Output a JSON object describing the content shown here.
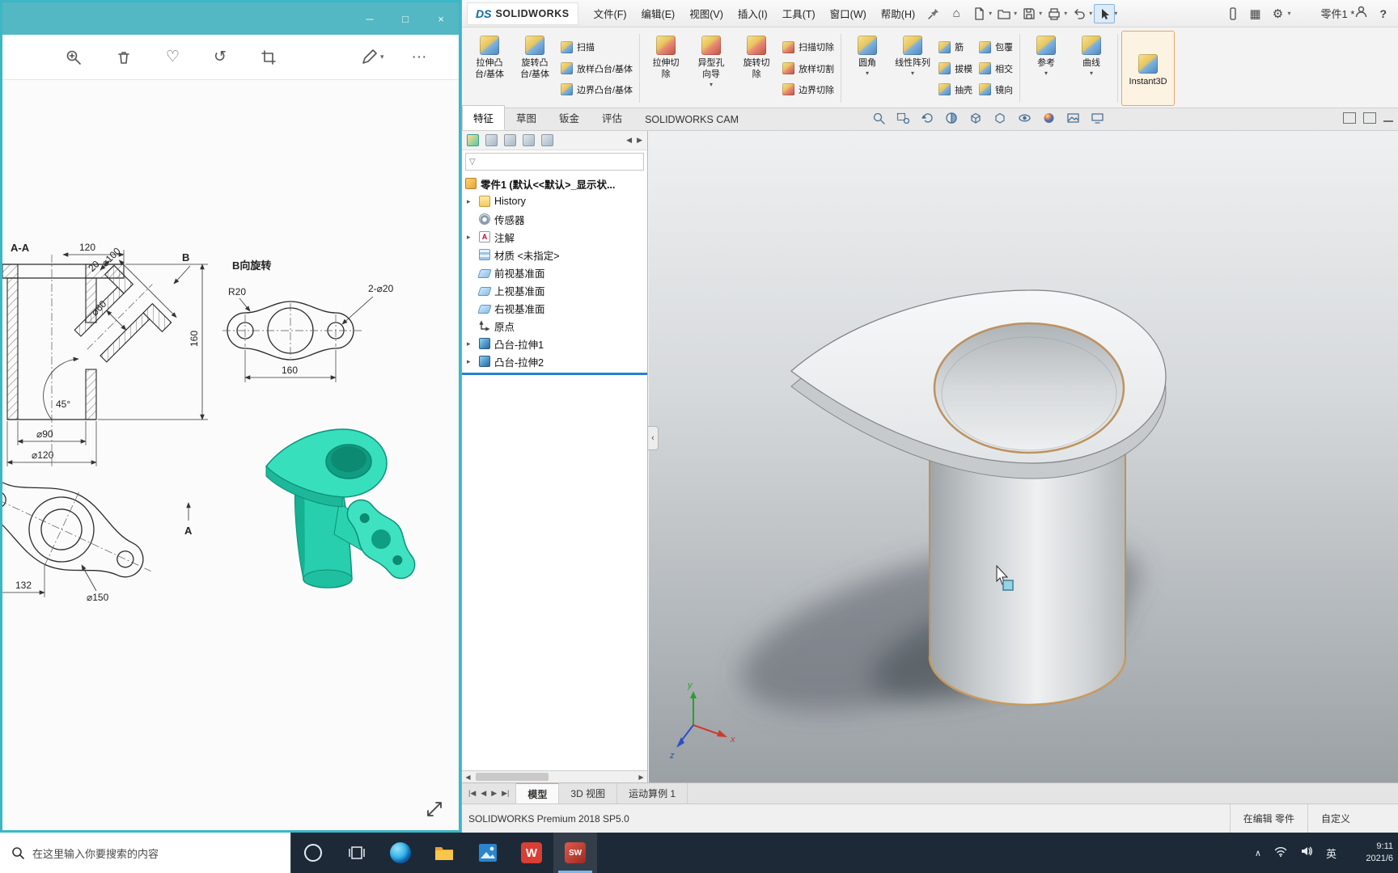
{
  "colors": {
    "viewer_accent": "#3db6c6",
    "taskbar_bg": "#1d2936",
    "model_teal": "#2ed9b6",
    "edge_highlight_tan": "#bd9260",
    "rollback_blue": "#2a7fd4"
  },
  "photo_viewer": {
    "drawing": {
      "section_view": {
        "label": "A-A",
        "datum": "B",
        "dim_top_width": "120",
        "dim_dia100": "⌀100",
        "dim_dia60": "⌀60",
        "dim_plate_thickness": "20",
        "dim_height": "160",
        "dim_angle": "45°",
        "dim_dia90": "⌀90",
        "dim_dia120": "⌀120"
      },
      "rotated_view": {
        "title": "B向旋转",
        "dim_radius": "R20",
        "dim_holes": "2-⌀20",
        "dim_span": "160"
      },
      "plan_view": {
        "datum": "A",
        "dim_width": "132",
        "dim_dia150": "⌀150"
      }
    }
  },
  "solidworks": {
    "brand_mark": "DS",
    "brand_name": "SOLIDWORKS",
    "menus": [
      "文件(F)",
      "编辑(E)",
      "视图(V)",
      "插入(I)",
      "工具(T)",
      "窗口(W)",
      "帮助(H)"
    ],
    "document_title": "零件1 *",
    "ribbon": {
      "extrude_boss": {
        "l1": "拉伸凸",
        "l2": "台/基体"
      },
      "revolve_boss": {
        "l1": "旋转凸",
        "l2": "台/基体"
      },
      "swept_boss": "扫描",
      "lofted_boss": "放样凸台/基体",
      "boundary_boss": "边界凸台/基体",
      "extrude_cut": {
        "l1": "拉伸切",
        "l2": "除"
      },
      "hole_wizard": {
        "l1": "异型孔",
        "l2": "向导"
      },
      "revolve_cut": {
        "l1": "旋转切",
        "l2": "除"
      },
      "swept_cut": "扫描切除",
      "lofted_cut": "放样切割",
      "boundary_cut": "边界切除",
      "fillet": "圆角",
      "linear_pattern": "线性阵列",
      "rib": "筋",
      "draft": "拔模",
      "shell": "抽壳",
      "wrap": "包覆",
      "intersect": "相交",
      "mirror": "镜向",
      "reference": "参考",
      "curves": "曲线",
      "instant3d": "Instant3D"
    },
    "command_tabs": [
      {
        "label": "特征"
      },
      {
        "label": "草图"
      },
      {
        "label": "钣金"
      },
      {
        "label": "评估"
      },
      {
        "label": "SOLIDWORKS CAM"
      }
    ],
    "feature_tree": {
      "root": "零件1 (默认<<默认>_显示状...",
      "items": [
        {
          "label": "History"
        },
        {
          "label": "传感器"
        },
        {
          "label": "注解"
        },
        {
          "label": "材质 <未指定>"
        },
        {
          "label": "前视基准面"
        },
        {
          "label": "上视基准面"
        },
        {
          "label": "右视基准面"
        },
        {
          "label": "原点"
        },
        {
          "label": "凸台-拉伸1"
        },
        {
          "label": "凸台-拉伸2"
        }
      ]
    },
    "triad": {
      "x": "x",
      "y": "y",
      "z": "z"
    },
    "doc_tabs": [
      {
        "label": "模型"
      },
      {
        "label": "3D 视图"
      },
      {
        "label": "运动算例 1"
      }
    ],
    "status_bar": {
      "product": "SOLIDWORKS Premium 2018 SP5.0",
      "mode": "在编辑 零件",
      "custom": "自定义"
    }
  },
  "taskbar": {
    "search_text": "在这里输入你要搜索的内容",
    "wps_glyph": "W",
    "solidworks_glyph": "SW",
    "ime": "英",
    "time": "9:11",
    "date": "2021/6"
  }
}
